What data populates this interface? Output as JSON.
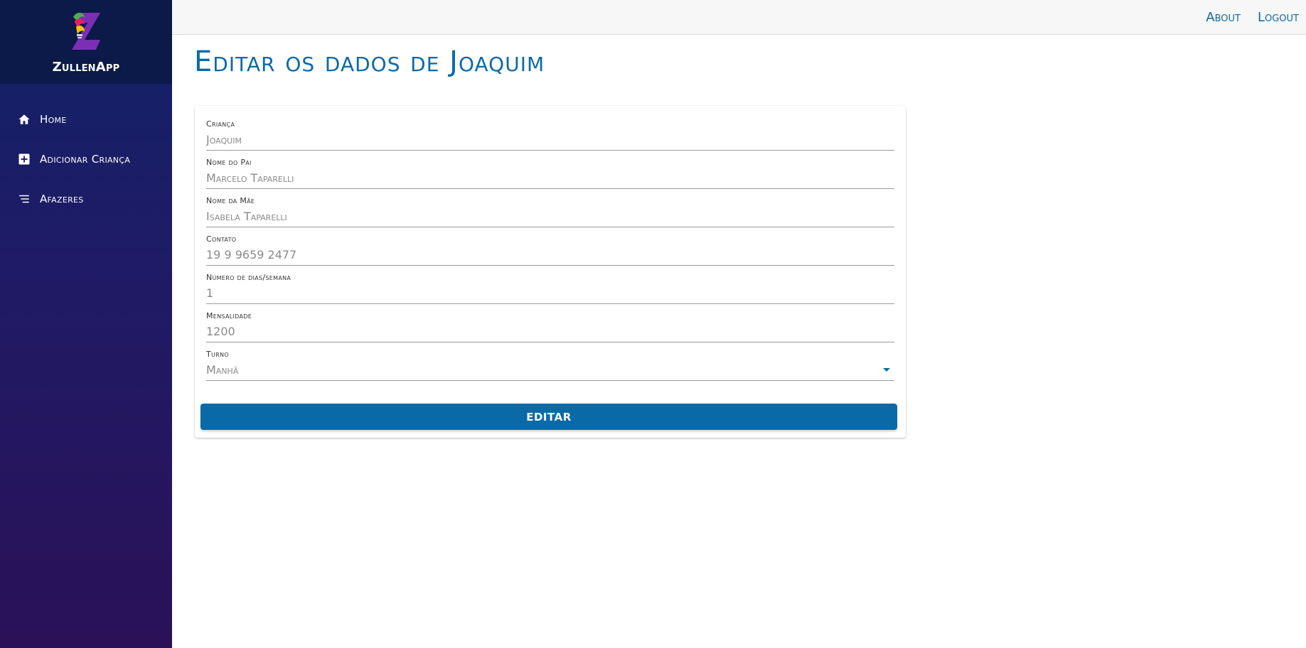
{
  "app": {
    "name": "ZullenApp",
    "logo_icon": "zullenapp-logo-icon"
  },
  "sidebar": {
    "items": [
      {
        "label": "Home",
        "icon": "home-icon"
      },
      {
        "label": "Adicionar Criança",
        "icon": "plus-box-icon"
      },
      {
        "label": "Afazeres",
        "icon": "list-icon"
      }
    ]
  },
  "topbar": {
    "about": "About",
    "logout": "Logout"
  },
  "page": {
    "title": "Editar os dados de Joaquim"
  },
  "form": {
    "crianca": {
      "label": "Criança",
      "value": "Joaquim"
    },
    "pai": {
      "label": "Nome do Pai",
      "value": "Marcelo Taparelli"
    },
    "mae": {
      "label": "Nome da Mãe",
      "value": "Isabela Taparelli"
    },
    "contato": {
      "label": "Contato",
      "value": "19 9 9659 2477"
    },
    "dias": {
      "label": "Número de dias/semana",
      "value": "1"
    },
    "mensalidade": {
      "label": "Mensalidade",
      "value": "1200"
    },
    "turno": {
      "label": "Turno",
      "value": "Manhã"
    },
    "submit_label": "EDITAR"
  },
  "colors": {
    "accent": "#0a6aa8",
    "sidebar_top": "#112266",
    "sidebar_bottom": "#2a1158"
  }
}
